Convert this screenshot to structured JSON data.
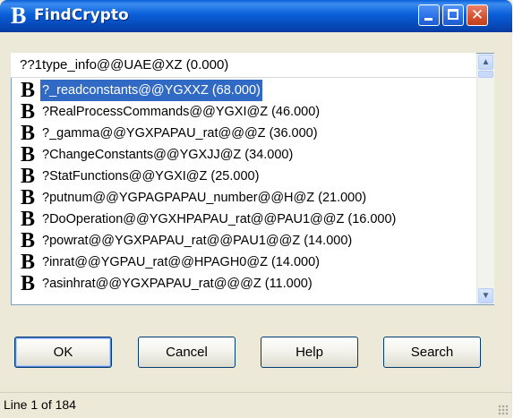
{
  "window": {
    "title": "FindCrypto",
    "icon_glyph": "B"
  },
  "list": {
    "header": "??1type_info@@UAE@XZ (0.000)",
    "item_icon": "B",
    "selected_index": 0,
    "items": [
      "?_readconstants@@YGXXZ (68.000)",
      "?RealProcessCommands@@YGXI@Z (46.000)",
      "?_gamma@@YGXPAPAU_rat@@@Z (36.000)",
      "?ChangeConstants@@YGXJJ@Z (34.000)",
      "?StatFunctions@@YGXI@Z (25.000)",
      "?putnum@@YGPAGPAPAU_number@@H@Z (21.000)",
      "?DoOperation@@YGXHPAPAU_rat@@PAU1@@Z (16.000)",
      "?powrat@@YGXPAPAU_rat@@PAU1@@Z (14.000)",
      "?inrat@@YGPAU_rat@@HPAGH0@Z (14.000)",
      "?asinhrat@@YGXPAPAU_rat@@@Z (11.000)"
    ]
  },
  "buttons": {
    "ok": "OK",
    "cancel": "Cancel",
    "help": "Help",
    "search": "Search"
  },
  "status": {
    "text": "Line 1 of 184"
  },
  "colors": {
    "titlebar": "#0a5fd8",
    "selection": "#316ac5",
    "dialog_bg": "#ece9d8"
  }
}
